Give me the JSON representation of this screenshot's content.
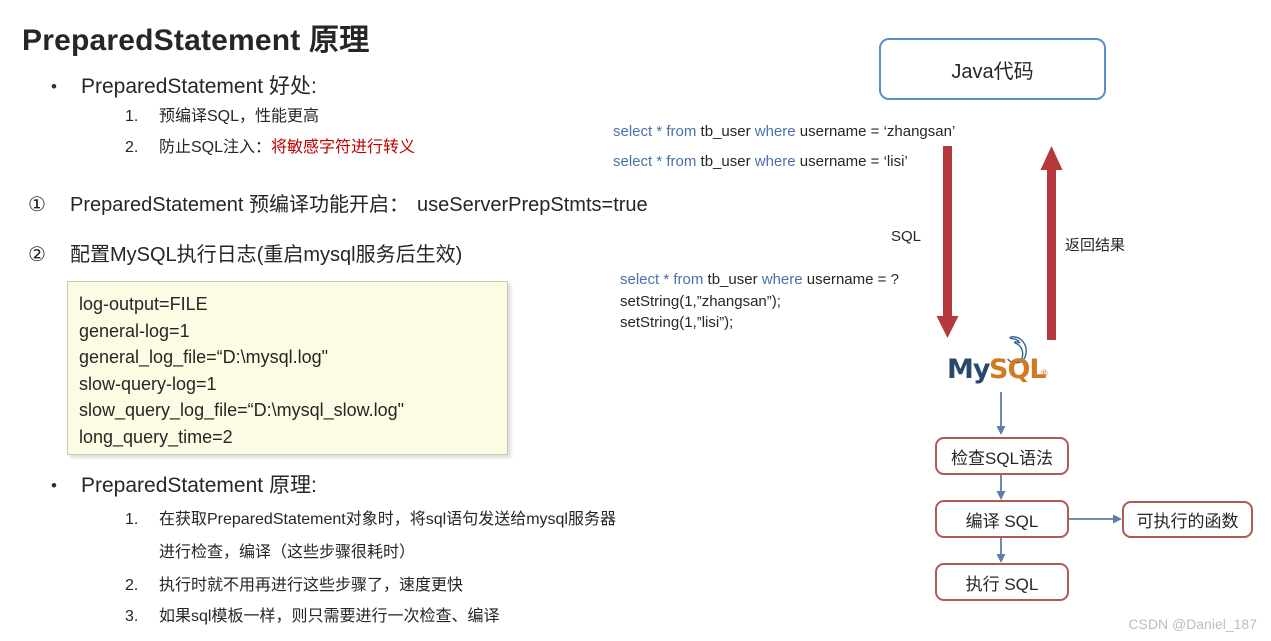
{
  "title": "PreparedStatement 原理",
  "left": {
    "bullet1": {
      "marker": "•",
      "text": "PreparedStatement 好处:"
    },
    "bullet1_items": [
      {
        "num": "1.",
        "text": "预编译SQL，性能更高",
        "highlight": ""
      },
      {
        "num": "2.",
        "text": "防止SQL注入：",
        "highlight": "将敏感字符进行转义"
      }
    ],
    "circled": [
      {
        "marker": "①",
        "text": "PreparedStatement 预编译功能开启：",
        "code": "useServerPrepStmts=true",
        "note": ""
      },
      {
        "marker": "②",
        "text": "配置MySQL执行日志",
        "code": "",
        "note": "(重启mysql服务后生效)"
      }
    ],
    "code_block": [
      "log-output=FILE",
      "general-log=1",
      "general_log_file=“D:\\mysql.log\"",
      "slow-query-log=1",
      "slow_query_log_file=“D:\\mysql_slow.log\"",
      "long_query_time=2"
    ],
    "bullet2": {
      "marker": "•",
      "text": "PreparedStatement 原理:"
    },
    "bullet2_items": [
      {
        "num": "1.",
        "text": "在获取PreparedStatement对象时，将sql语句发送给mysql服务器"
      },
      {
        "num": "",
        "text": "进行检查，编译（这些步骤很耗时）"
      },
      {
        "num": "2.",
        "text": "执行时就不用再进行这些步骤了，速度更快"
      },
      {
        "num": "3.",
        "text": "如果sql模板一样，则只需要进行一次检查、编译"
      }
    ]
  },
  "diagram": {
    "java_box": "Java代码",
    "sql_statements_top": [
      {
        "kw1": "select",
        "star": " * ",
        "kw2": "from",
        "tbl": " tb_user ",
        "kw3": "where",
        "rest": " username = ‘zhangsan’"
      },
      {
        "kw1": "select",
        "star": " * ",
        "kw2": "from",
        "tbl": " tb_user ",
        "kw3": "where",
        "rest": " username = ‘lisi’"
      }
    ],
    "sql_statements_mid": [
      {
        "kw1": "select",
        "star": " * ",
        "kw2": "from",
        "tbl": " tb_user ",
        "kw3": "where",
        "rest": " username = ?"
      }
    ],
    "set_lines": [
      "setString(1,”zhangsan”);",
      "setString(1,”lisi”);"
    ],
    "arrow_down_label": "SQL",
    "arrow_up_label": "返回结果",
    "mysql_logo": {
      "part1": "My",
      "part2": "SQL",
      "reg": "®"
    },
    "flow": [
      {
        "label": "检查SQL语法"
      },
      {
        "label": "编译 SQL"
      },
      {
        "label": "执行 SQL"
      },
      {
        "label": "可执行的函数"
      }
    ]
  },
  "watermark": "CSDN @Daniel_187",
  "colors": {
    "accent_red": "#b5393c",
    "box_border_red": "#b05a56",
    "box_border_blue": "#5b8fc9",
    "arrow_blue": "#5b7fa6",
    "code_bg": "#fcfbe3",
    "green_code": "#1e7a35",
    "red_text": "#c00000",
    "sql_keyword": "#4a72a8"
  }
}
